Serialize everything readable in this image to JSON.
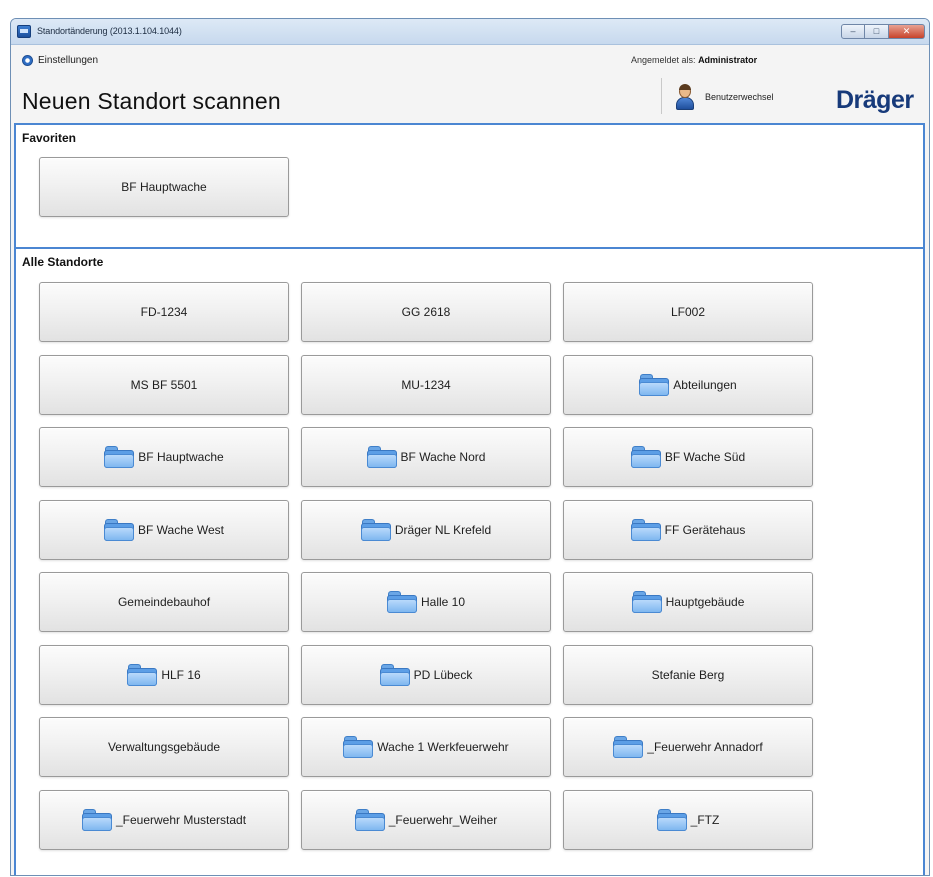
{
  "window": {
    "title": "Standortänderung (2013.1.104.1044)",
    "controls": {
      "minimize": "–",
      "maximize": "□",
      "close": "✕"
    }
  },
  "header": {
    "settings_label": "Einstellungen",
    "page_title": "Neuen Standort scannen",
    "logged_in_prefix": "Angemeldet als:",
    "logged_in_user": "Administrator",
    "user_switch_label": "Benutzerwechsel",
    "logo_text": "Dräger"
  },
  "favorites": {
    "label": "Favoriten",
    "items": [
      {
        "label": "BF Hauptwache",
        "folder": false
      }
    ]
  },
  "all_locations": {
    "label": "Alle Standorte",
    "items": [
      {
        "label": "FD-1234",
        "folder": false
      },
      {
        "label": "GG 2618",
        "folder": false
      },
      {
        "label": "LF002",
        "folder": false
      },
      {
        "label": "MS BF 5501",
        "folder": false
      },
      {
        "label": "MU-1234",
        "folder": false
      },
      {
        "label": "Abteilungen",
        "folder": true
      },
      {
        "label": "BF Hauptwache",
        "folder": true
      },
      {
        "label": "BF Wache Nord",
        "folder": true
      },
      {
        "label": "BF Wache Süd",
        "folder": true
      },
      {
        "label": "BF Wache West",
        "folder": true
      },
      {
        "label": "Dräger NL Krefeld",
        "folder": true
      },
      {
        "label": "FF Gerätehaus",
        "folder": true
      },
      {
        "label": "Gemeindebauhof",
        "folder": false
      },
      {
        "label": "Halle 10",
        "folder": true
      },
      {
        "label": "Hauptgebäude",
        "folder": true
      },
      {
        "label": "HLF 16",
        "folder": true
      },
      {
        "label": "PD Lübeck",
        "folder": true
      },
      {
        "label": "Stefanie Berg",
        "folder": false
      },
      {
        "label": "Verwaltungsgebäude",
        "folder": false
      },
      {
        "label": "Wache 1 Werkfeuerwehr",
        "folder": true
      },
      {
        "label": "_Feuerwehr Annadorf",
        "folder": true
      },
      {
        "label": "_Feuerwehr Musterstadt",
        "folder": true
      },
      {
        "label": "_Feuerwehr_Weiher",
        "folder": true
      },
      {
        "label": "_FTZ",
        "folder": true
      }
    ]
  },
  "colors": {
    "accent": "#4b86d2",
    "logo": "#173a7a"
  }
}
